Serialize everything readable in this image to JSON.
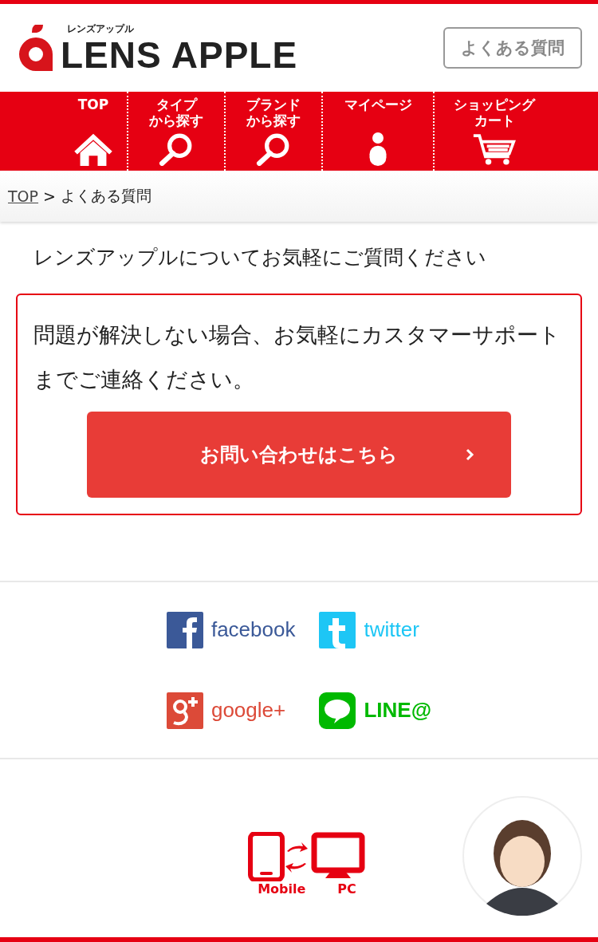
{
  "header": {
    "logo_kana": "レンズアップル",
    "logo_text": "LENS APPLE",
    "faq_button": "よくある質問"
  },
  "nav": [
    {
      "lines": [
        "TOP"
      ],
      "kind": "home"
    },
    {
      "lines": [
        "タイプ",
        "から探す"
      ],
      "kind": "search"
    },
    {
      "lines": [
        "ブランド",
        "から探す"
      ],
      "kind": "search"
    },
    {
      "lines": [
        "マイページ"
      ],
      "kind": "person"
    },
    {
      "lines": [
        "ショッピング",
        "カート"
      ],
      "kind": "cart"
    }
  ],
  "breadcrumb": {
    "link": "TOP",
    "separator": ">",
    "current": "よくある質問"
  },
  "intro": "レンズアップルについてお気軽にご質問ください",
  "support": {
    "message": "問題が解決しない場合、お気軽にカスタマーサポートまでご連絡ください。",
    "button": "お問い合わせはこちら"
  },
  "social": [
    {
      "kind": "facebook",
      "label": "facebook",
      "color": "#3b5998"
    },
    {
      "kind": "twitter",
      "label": "twitter",
      "color": "#1dc6f5"
    },
    {
      "kind": "google",
      "label": "google+",
      "color": "#dc4a38"
    },
    {
      "kind": "line",
      "label": "LINE@",
      "color": "#00b900"
    }
  ],
  "footer": {
    "mobile_label": "Mobile",
    "pc_label": "PC"
  }
}
